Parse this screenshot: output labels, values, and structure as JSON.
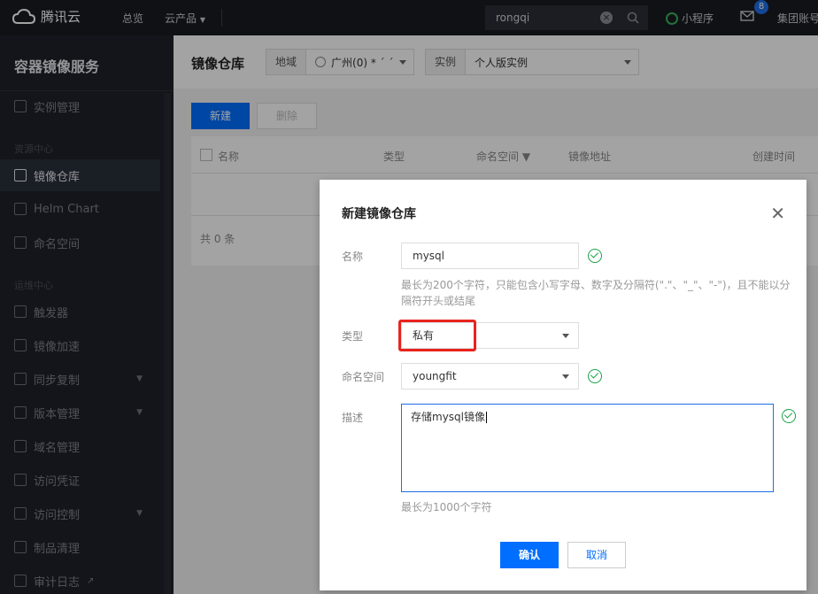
{
  "topnav": {
    "brand": "腾讯云",
    "links": [
      "总览",
      "云产品"
    ],
    "search_value": "rongqi",
    "mini_program": "小程序",
    "mail_badge": "8",
    "account": "集团账号"
  },
  "sidebar": {
    "service_title": "容器镜像服务",
    "items": [
      {
        "label": "实例管理",
        "icon": "layers-icon"
      },
      {
        "label": "镜像仓库",
        "icon": "image-repo-icon"
      },
      {
        "label": "Helm Chart",
        "icon": "helm-icon"
      },
      {
        "label": "命名空间",
        "icon": "namespace-icon"
      },
      {
        "label": "触发器",
        "icon": "trigger-icon"
      },
      {
        "label": "镜像加速",
        "icon": "lightning-icon"
      },
      {
        "label": "同步复制",
        "icon": "sync-icon"
      },
      {
        "label": "版本管理",
        "icon": "folder-icon"
      },
      {
        "label": "域名管理",
        "icon": "domain-icon"
      },
      {
        "label": "访问凭证",
        "icon": "credential-icon"
      },
      {
        "label": "访问控制",
        "icon": "lock-icon"
      },
      {
        "label": "制品清理",
        "icon": "trash-icon"
      },
      {
        "label": "审计日志",
        "icon": "log-icon"
      }
    ],
    "groups": [
      "资源中心",
      "运维中心"
    ]
  },
  "main": {
    "title": "镜像仓库",
    "region_label": "地域",
    "region_value": "广州(0) * ˊ ˊ",
    "instance_label": "实例",
    "instance_value": "个人版实例",
    "new_button": "新建",
    "delete_button": "删除",
    "columns": [
      "名称",
      "类型",
      "命名空间",
      "镜像地址",
      "创建时间"
    ],
    "total": "共 0 条"
  },
  "modal": {
    "title": "新建镜像仓库",
    "name_label": "名称",
    "name_value": "mysql",
    "name_hint": "最长为200个字符，只能包含小写字母、数字及分隔符(\".\"、\"_\"、\"-\")，且不能以分隔符开头或结尾",
    "type_label": "类型",
    "type_value": "私有",
    "namespace_label": "命名空间",
    "namespace_value": "youngfit",
    "desc_label": "描述",
    "desc_value": "存储mysql镜像",
    "desc_hint": "最长为1000个字符",
    "confirm": "确认",
    "cancel": "取消"
  }
}
